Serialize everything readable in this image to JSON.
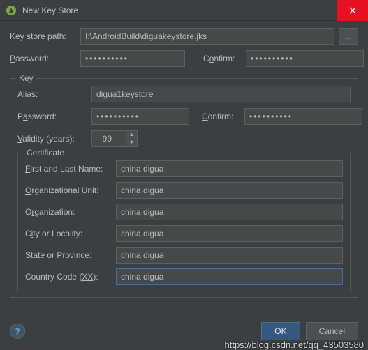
{
  "window": {
    "title": "New Key Store"
  },
  "fields": {
    "keystore_path_label": "Key store path:",
    "keystore_path_value": "I:\\AndroidBuild\\diguakeystore.jks",
    "password_label": "Password:",
    "password_value": "••••••••••",
    "confirm_label": "Confirm:",
    "confirm_value": "••••••••••"
  },
  "key": {
    "legend": "Key",
    "alias_label": "Alias:",
    "alias_value": "digua1keystore",
    "password_label": "Password:",
    "password_value": "••••••••••",
    "confirm_label": "Confirm:",
    "confirm_value": "••••••••••",
    "validity_label": "Validity (years):",
    "validity_value": "99"
  },
  "cert": {
    "legend": "Certificate",
    "first_last_label": "First and Last Name:",
    "first_last_value": "china digua",
    "org_unit_label": "Organizational Unit:",
    "org_unit_value": "china digua",
    "org_label": "Organization:",
    "org_value": "china digua",
    "city_label": "City or Locality:",
    "city_value": "china digua",
    "state_label": "State or Province:",
    "state_value": "china digua",
    "country_label": "Country Code (XX):",
    "country_value": "china digua"
  },
  "buttons": {
    "ok": "OK",
    "cancel": "Cancel",
    "browse": "...",
    "help": "?"
  },
  "watermark": "https://blog.csdn.net/qq_43503580"
}
